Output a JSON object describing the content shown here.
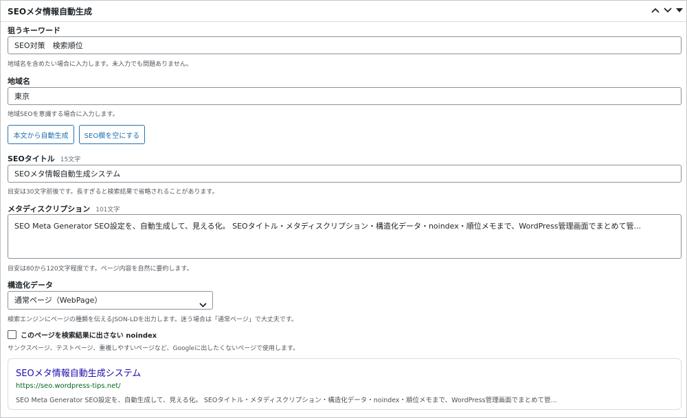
{
  "panel": {
    "title": "SEOメタ情報自動生成",
    "collapse_up_icon": "chevron-up-icon",
    "collapse_down_icon": "chevron-down-icon",
    "toggle_icon": "triangle-down-icon"
  },
  "keyword": {
    "label": "狙うキーワード",
    "value": "SEO対策　検索順位",
    "help": "地域名を含めたい場合に入力します。未入力でも問題ありません。"
  },
  "region": {
    "label": "地域名",
    "value": "東京",
    "help": "地域SEOを意識する場合に入力します。"
  },
  "buttons": {
    "generate": "本文から自動生成",
    "clear": "SEO欄を空にする"
  },
  "seo_title": {
    "label": "SEOタイトル",
    "count": "15文字",
    "value": "SEOメタ情報自動生成システム",
    "help": "目安は30文字前後です。長すぎると検索結果で省略されることがあります。"
  },
  "meta_description": {
    "label": "メタディスクリプション",
    "count": "101文字",
    "value": "SEO Meta Generator SEO設定を、自動生成して、見える化。 SEOタイトル・メタディスクリプション・構造化データ・noindex・順位メモまで、WordPress管理画面でまとめて管...",
    "help": "目安は80から120文字程度です。ページ内容を自然に要約します。"
  },
  "structured_data": {
    "label": "構造化データ",
    "selected": "通常ページ（WebPage）",
    "help": "検索エンジンにページの種類を伝えるJSON-LDを出力します。迷う場合は「通常ページ」で大丈夫です。"
  },
  "noindex": {
    "label": "このページを検索結果に出さない noindex",
    "checked": false,
    "help": "サンクスページ、テストページ、重複しやすいページなど、Googleに出したくないページで使用します。"
  },
  "preview": {
    "title": "SEOメタ情報自動生成システム",
    "url": "https://seo.wordpress-tips.net/",
    "description": "SEO Meta Generator SEO設定を、自動生成して、見える化。 SEOタイトル・メタディスクリプション・構造化データ・noindex・順位メモまで、WordPress管理画面でまとめて管..."
  },
  "colors": {
    "accent": "#2271b1",
    "preview_title": "#1a0dab",
    "preview_url": "#006621"
  }
}
